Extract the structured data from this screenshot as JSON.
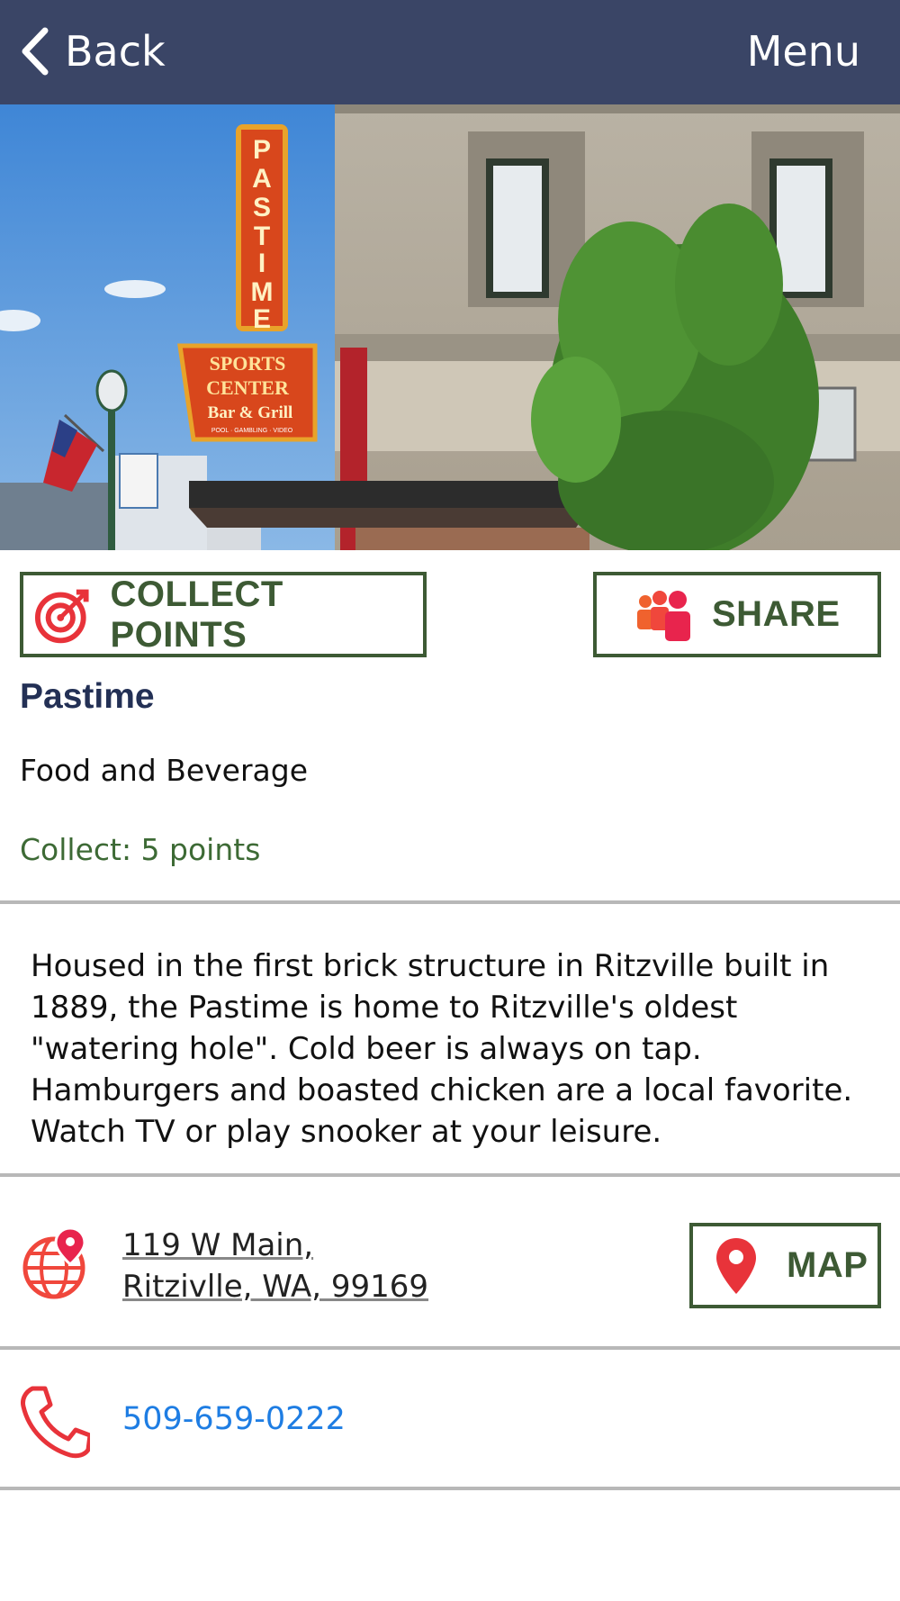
{
  "nav": {
    "back_label": "Back",
    "menu_label": "Menu",
    "bar_color": "#3a4566"
  },
  "hero": {
    "sign": {
      "name": "PASTIME",
      "line1": "SPORTS",
      "line2": "CENTER",
      "line3": "Bar & Grill",
      "line4": "POOL · GAMBLING · VIDEO"
    }
  },
  "actions": {
    "collect_label": "COLLECT POINTS",
    "share_label": "SHARE",
    "map_label": "MAP"
  },
  "place": {
    "name": "Pastime",
    "category": "Food and Beverage",
    "points_text": "Collect: 5 points",
    "description": "Housed in the first brick structure in Ritzville built in 1889, the Pastime is home to Ritzville's oldest \"watering hole\".  Cold beer is always on tap. Hamburgers and boasted chicken are a local favorite. Watch TV or play snooker at your leisure.",
    "address_line1": "119 W Main,",
    "address_line2": "Ritzivlle, WA, 99169",
    "phone": "509-659-0222"
  },
  "colors": {
    "accent_green": "#3d5a34",
    "title_navy": "#233055",
    "icon_red": "#e8333a",
    "link_blue": "#1e7de3"
  },
  "icons": [
    "chevron-left-icon",
    "target-arrow-icon",
    "people-icon",
    "globe-pin-icon",
    "map-pin-icon",
    "phone-icon"
  ]
}
